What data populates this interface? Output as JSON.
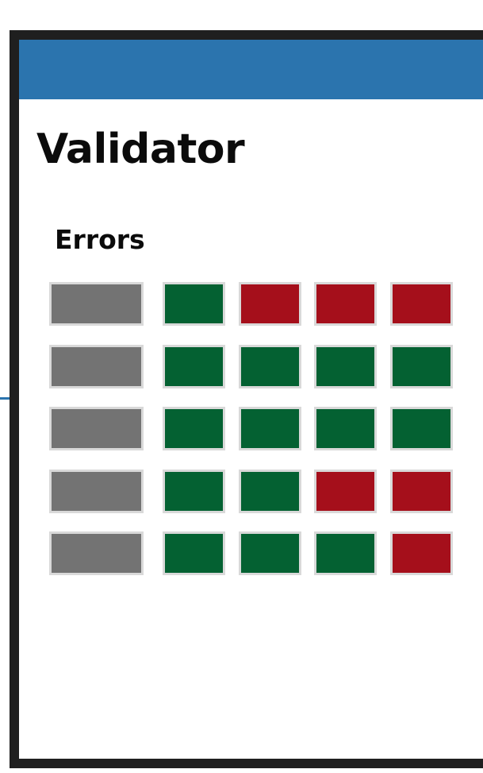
{
  "app": {
    "title": "Validator"
  },
  "section": {
    "label": "Errors"
  },
  "colors": {
    "header": "#2b74ae",
    "frame": "#1f1f1f",
    "label_cell": "#737373",
    "pass": "#046132",
    "fail": "#a50f1b",
    "cell_border": "#d9d9d9"
  },
  "grid": {
    "rows": [
      {
        "statuses": [
          "pass",
          "fail",
          "fail",
          "fail"
        ]
      },
      {
        "statuses": [
          "pass",
          "pass",
          "pass",
          "pass"
        ]
      },
      {
        "statuses": [
          "pass",
          "pass",
          "pass",
          "pass"
        ]
      },
      {
        "statuses": [
          "pass",
          "pass",
          "fail",
          "fail"
        ]
      },
      {
        "statuses": [
          "pass",
          "pass",
          "pass",
          "fail"
        ]
      }
    ]
  }
}
